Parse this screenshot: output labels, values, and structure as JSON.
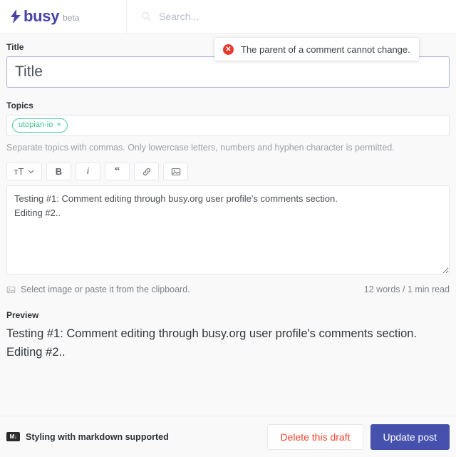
{
  "header": {
    "brand_name": "busy",
    "brand_tag": "beta",
    "logo_icon": "lightning-bolt-icon",
    "search_icon": "search-icon",
    "search_placeholder": "Search...",
    "search_value": ""
  },
  "toast": {
    "icon": "error-circle-icon",
    "icon_glyph": "✕",
    "message": "The parent of a comment cannot change."
  },
  "form": {
    "title_label": "Title",
    "title_placeholder": "Title",
    "title_value": "",
    "topics_label": "Topics",
    "topics": [
      {
        "name": "utopian-io",
        "remove_glyph": "×"
      }
    ],
    "topics_helper": "Separate topics with commas. Only lowercase letters, numbers and hyphen character is permitted."
  },
  "toolbar": {
    "buttons": [
      {
        "name": "heading",
        "glyph": "тT",
        "has_chevron": true
      },
      {
        "name": "bold",
        "glyph": "B",
        "has_chevron": false
      },
      {
        "name": "italic",
        "glyph": "i",
        "has_chevron": false
      },
      {
        "name": "quote",
        "glyph": "“",
        "has_chevron": false
      },
      {
        "name": "link",
        "glyph": "link-icon",
        "has_chevron": false
      },
      {
        "name": "image",
        "glyph": "image-icon",
        "has_chevron": false
      }
    ]
  },
  "editor": {
    "body_text": "Testing #1: Comment editing through busy.org user profile's comments section.\nEditing #2..",
    "image_hint_icon": "image-icon",
    "image_hint": "Select image or paste it from the clipboard.",
    "word_count": "12 words / 1 min read"
  },
  "preview": {
    "label": "Preview",
    "text": "Testing #1: Comment editing through busy.org user profile's comments section. Editing #2.."
  },
  "footer": {
    "markdown_badge": "M↓",
    "markdown_note": "Styling with markdown supported",
    "delete_label": "Delete this draft",
    "update_label": "Update post"
  },
  "colors": {
    "brand": "#4844a8",
    "primary_button": "#4551ac",
    "danger_text": "#f0442e",
    "error_icon": "#e8392e",
    "topic_green": "#3fc392",
    "focus_border": "#a9b3e0"
  }
}
